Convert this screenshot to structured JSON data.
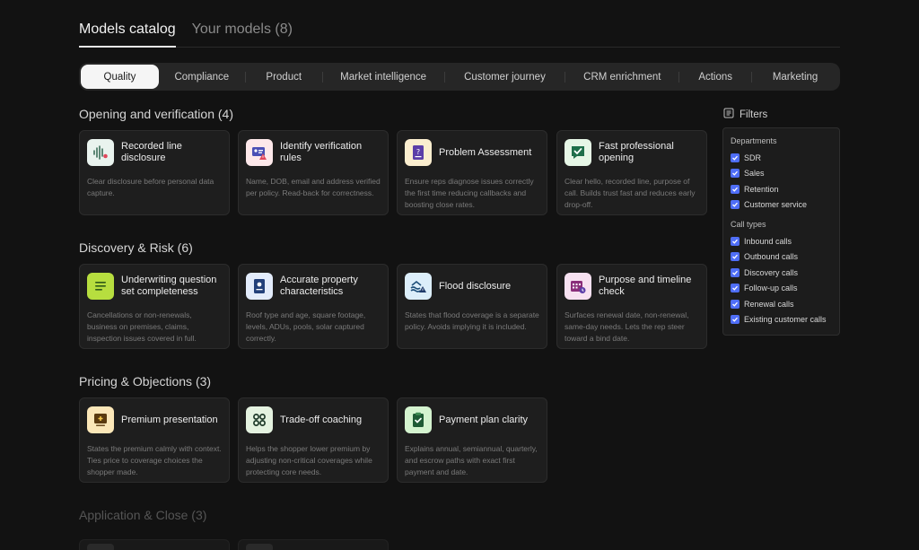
{
  "top_tabs": [
    {
      "label": "Models catalog"
    },
    {
      "label": "Your models (8)"
    }
  ],
  "segments": [
    {
      "label": "Quality"
    },
    {
      "label": "Compliance"
    },
    {
      "label": "Product"
    },
    {
      "label": "Market intelligence"
    },
    {
      "label": "Customer journey"
    },
    {
      "label": "CRM enrichment"
    },
    {
      "label": "Actions"
    },
    {
      "label": "Marketing"
    }
  ],
  "sections": [
    {
      "title": "Opening and verification (4)",
      "cards": [
        {
          "title": "Recorded line disclosure",
          "desc": "Clear disclosure before personal data capture.",
          "icon": "waveform-icon"
        },
        {
          "title": "Identify verification rules",
          "desc": "Name, DOB, email and address verified per policy. Read-back for correctness.",
          "icon": "id-card-warning-icon"
        },
        {
          "title": "Problem Assessment",
          "desc": "Ensure reps diagnose issues correctly the first time reducing callbacks and boosting close rates.",
          "icon": "question-document-icon"
        },
        {
          "title": "Fast professional opening",
          "desc": "Clear hello, recorded line, purpose of call. Builds trust fast and reduces early drop-off.",
          "icon": "check-message-icon"
        }
      ]
    },
    {
      "title": "Discovery & Risk (6)",
      "cards": [
        {
          "title": "Underwriting question set completeness",
          "desc": "Cancellations or non-renewals, business on premises, claims, inspection issues covered in full.",
          "icon": "list-icon"
        },
        {
          "title": "Accurate property characteristics",
          "desc": "Roof type and age, square footage, levels, ADUs, pools, solar captured correctly.",
          "icon": "property-document-icon"
        },
        {
          "title": "Flood disclosure",
          "desc": "States that flood coverage is a separate policy. Avoids implying it is included.",
          "icon": "flood-warning-icon"
        },
        {
          "title": "Purpose and timeline check",
          "desc": "Surfaces renewal date, non-renewal, same-day needs. Lets the rep steer toward a bind date.",
          "icon": "calendar-clock-icon"
        }
      ]
    },
    {
      "title": "Pricing & Objections (3)",
      "cards": [
        {
          "title": "Premium presentation",
          "desc": "States the premium calmly with context. Ties price to coverage choices the shopper made.",
          "icon": "presentation-icon"
        },
        {
          "title": "Trade-off coaching",
          "desc": "Helps the shopper lower premium by adjusting non-critical coverages while protecting core needs.",
          "icon": "grid-circles-icon"
        },
        {
          "title": "Payment plan clarity",
          "desc": "Explains annual, semiannual, quarterly, and escrow paths with exact first payment and date.",
          "icon": "clipboard-check-icon"
        }
      ]
    },
    {
      "title": "Application & Close (3)",
      "cards": []
    }
  ],
  "filters": {
    "label": "Filters",
    "groups": [
      {
        "title": "Departments",
        "items": [
          "SDR",
          "Sales",
          "Retention",
          "Customer service"
        ]
      },
      {
        "title": "Call types",
        "items": [
          "Inbound calls",
          "Outbound calls",
          "Discovery calls",
          "Follow-up calls",
          "Renewal calls",
          "Existing customer calls"
        ]
      }
    ]
  },
  "colors": {
    "background": "#121212",
    "card": "#1e1e1e",
    "checkbox": "#4f6ef7",
    "active_segment": "#f5f5f5"
  }
}
